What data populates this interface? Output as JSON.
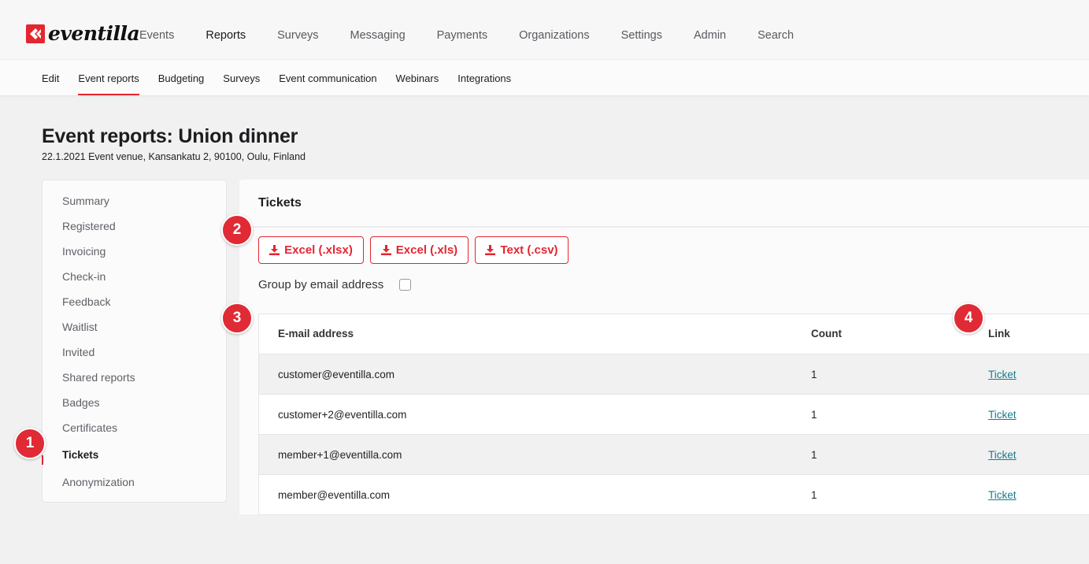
{
  "brand": {
    "name": "eventilla",
    "accent": "#e4262f"
  },
  "topnav": {
    "items": [
      "Events",
      "Reports",
      "Surveys",
      "Messaging",
      "Payments",
      "Organizations",
      "Settings",
      "Admin",
      "Search"
    ],
    "active": "Reports"
  },
  "subnav": {
    "items": [
      "Edit",
      "Event reports",
      "Budgeting",
      "Surveys",
      "Event communication",
      "Webinars",
      "Integrations"
    ],
    "active": "Event reports"
  },
  "page": {
    "title": "Event reports: Union dinner",
    "subtitle": "22.1.2021 Event venue, Kansankatu 2, 90100, Oulu, Finland"
  },
  "sidebar": {
    "items": [
      "Summary",
      "Registered",
      "Invoicing",
      "Check-in",
      "Feedback",
      "Waitlist",
      "Invited",
      "Shared reports",
      "Badges",
      "Certificates",
      "Tickets",
      "Anonymization"
    ],
    "active": "Tickets"
  },
  "tickets": {
    "title": "Tickets",
    "downloads": [
      "Excel (.xlsx)",
      "Excel (.xls)",
      "Text (.csv)"
    ],
    "download_icon": "download-icon",
    "group_label": "Group by email address",
    "group_checked": false,
    "columns": [
      "E-mail address",
      "Count",
      "Link"
    ],
    "rows": [
      {
        "email": "customer@eventilla.com",
        "count": "1",
        "link": "Ticket"
      },
      {
        "email": "customer+2@eventilla.com",
        "count": "1",
        "link": "Ticket"
      },
      {
        "email": "member+1@eventilla.com",
        "count": "1",
        "link": "Ticket"
      },
      {
        "email": "member@eventilla.com",
        "count": "1",
        "link": "Ticket"
      }
    ]
  },
  "callouts": [
    "1",
    "2",
    "3",
    "4"
  ]
}
